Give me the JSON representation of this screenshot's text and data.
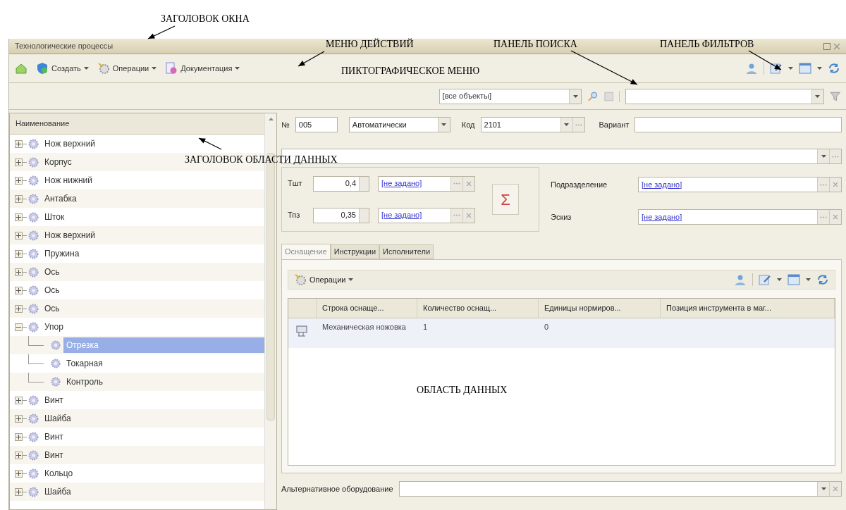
{
  "annotations": [
    {
      "text": "ЗАГОЛОВОК ОКНА"
    },
    {
      "text": "МЕНЮ ДЕЙСТВИЙ"
    },
    {
      "text": "ПАНЕЛЬ ПОИСКА"
    },
    {
      "text": "ПАНЕЛЬ ФИЛЬТРОВ"
    },
    {
      "text": "ПИКТОГРАФИЧЕСКОЕ МЕНЮ"
    },
    {
      "text": "ЗАГОЛОВОК ОБЛАСТИ ДАННЫХ"
    },
    {
      "text": "ОБЛАСТЬ ДАННЫХ"
    }
  ],
  "window": {
    "title": "Технологические процессы"
  },
  "toolbar": {
    "actions": [
      {
        "label": "Создать"
      },
      {
        "label": "Операции"
      },
      {
        "label": "Документация"
      }
    ]
  },
  "search": {
    "scope": "[все объекты]"
  },
  "tree": {
    "header": "Наименование",
    "items": [
      {
        "label": "Нож верхний",
        "expanded": false,
        "selected": false
      },
      {
        "label": "Корпус",
        "expanded": false,
        "selected": false
      },
      {
        "label": "Нож нижний",
        "expanded": false,
        "selected": false
      },
      {
        "label": "Антабка",
        "expanded": false,
        "selected": false
      },
      {
        "label": "Шток",
        "expanded": false,
        "selected": false
      },
      {
        "label": "Нож верхний",
        "expanded": false,
        "selected": false
      },
      {
        "label": "Пружина",
        "expanded": false,
        "selected": false
      },
      {
        "label": "Ось",
        "expanded": false,
        "selected": false
      },
      {
        "label": "Ось",
        "expanded": false,
        "selected": false
      },
      {
        "label": "Ось",
        "expanded": false,
        "selected": false
      },
      {
        "label": "Упор",
        "expanded": true,
        "selected": false,
        "children": [
          {
            "label": "Отрезка",
            "selected": true
          },
          {
            "label": "Токарная",
            "selected": false
          },
          {
            "label": "Контроль",
            "selected": false
          }
        ]
      },
      {
        "label": "Винт",
        "expanded": false,
        "selected": false
      },
      {
        "label": "Шайба",
        "expanded": false,
        "selected": false
      },
      {
        "label": "Винт",
        "expanded": false,
        "selected": false
      },
      {
        "label": "Винт",
        "expanded": false,
        "selected": false
      },
      {
        "label": "Кольцо",
        "expanded": false,
        "selected": false
      },
      {
        "label": "Шайба",
        "expanded": false,
        "selected": false
      }
    ]
  },
  "form": {
    "number_label": "№",
    "number": "005",
    "numbering": "Автоматически",
    "code_label": "Код",
    "code": "2101",
    "variant_label": "Вариант",
    "tsht_label": "Тшт",
    "tsht": "0,4",
    "tsht_link": "[не задано]",
    "tpz_label": "Тпз",
    "tpz": "0,35",
    "tpz_link": "[не задано]",
    "sum_symbol": "Σ",
    "department_label": "Подразделение",
    "department": "[не задано]",
    "sketch_label": "Эскиз",
    "sketch": "[не задано]"
  },
  "tabs": [
    {
      "label": "Оснащение",
      "selected": true
    },
    {
      "label": "Инструкции",
      "selected": false
    },
    {
      "label": "Исполнители",
      "selected": false
    }
  ],
  "subtoolbar": {
    "label": "Операции"
  },
  "table": {
    "columns": [
      "Строка оснаще...",
      "Количество оснащ...",
      "Единицы нормиров...",
      "Позиция инструмента в маг..."
    ],
    "rows": [
      {
        "cells": [
          "Механическая ножовка",
          "1",
          "0",
          ""
        ]
      }
    ]
  },
  "alt_equipment_label": "Альтернативное оборудование"
}
